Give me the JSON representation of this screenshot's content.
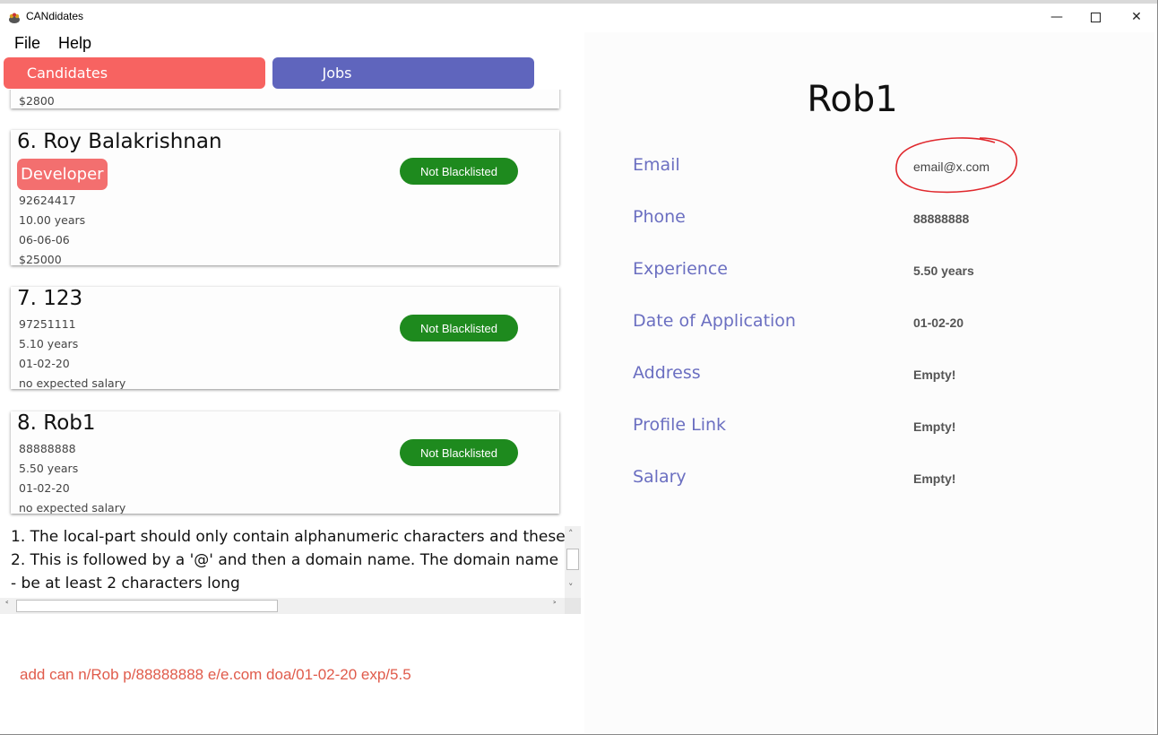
{
  "window": {
    "title": "CANdidates"
  },
  "menu": [
    "File",
    "Help"
  ],
  "tabs": [
    {
      "label": "Candidates",
      "color": "#f76361",
      "active": true
    },
    {
      "label": "Jobs",
      "color": "#5f65bd",
      "active": false
    }
  ],
  "partial_card": {
    "salary": "$2800"
  },
  "candidates": [
    {
      "title": "6.  Roy Balakrishnan",
      "tag": "Developer",
      "status": "Not Blacklisted",
      "phone": "92624417",
      "experience": "10.00 years",
      "date": "06-06-06",
      "salary": "$25000"
    },
    {
      "title": "7.  123",
      "status": "Not Blacklisted",
      "phone": "97251111",
      "experience": "5.10 years",
      "date": "01-02-20",
      "salary": "no expected salary"
    },
    {
      "title": "8.  Rob1",
      "status": "Not Blacklisted",
      "phone": "88888888",
      "experience": "5.50 years",
      "date": "01-02-20",
      "salary": "no expected salary"
    }
  ],
  "result_lines": [
    "1. The local-part should only contain alphanumeric characters and these",
    "2. This is followed by a '@' and then a domain name. The domain name",
    "    - be at least 2 characters long"
  ],
  "command": "add can n/Rob p/88888888 e/e.com doa/01-02-20 exp/5.5",
  "detail": {
    "name": "Rob1",
    "fields": [
      {
        "label": "Email",
        "value": "email@x.com"
      },
      {
        "label": "Phone",
        "value": "88888888"
      },
      {
        "label": "Experience",
        "value": "5.50 years"
      },
      {
        "label": "Date of Application",
        "value": "01-02-20"
      },
      {
        "label": "Address",
        "value": "Empty!"
      },
      {
        "label": "Profile Link",
        "value": "Empty!"
      },
      {
        "label": "Salary",
        "value": "Empty!"
      }
    ]
  },
  "colors": {
    "accent_label": "#6b6fc1",
    "status_green": "#1e8a1e",
    "tag_red": "#f36f6f",
    "command_red": "#e05b4b",
    "annotation_circle": "#e0282d"
  }
}
